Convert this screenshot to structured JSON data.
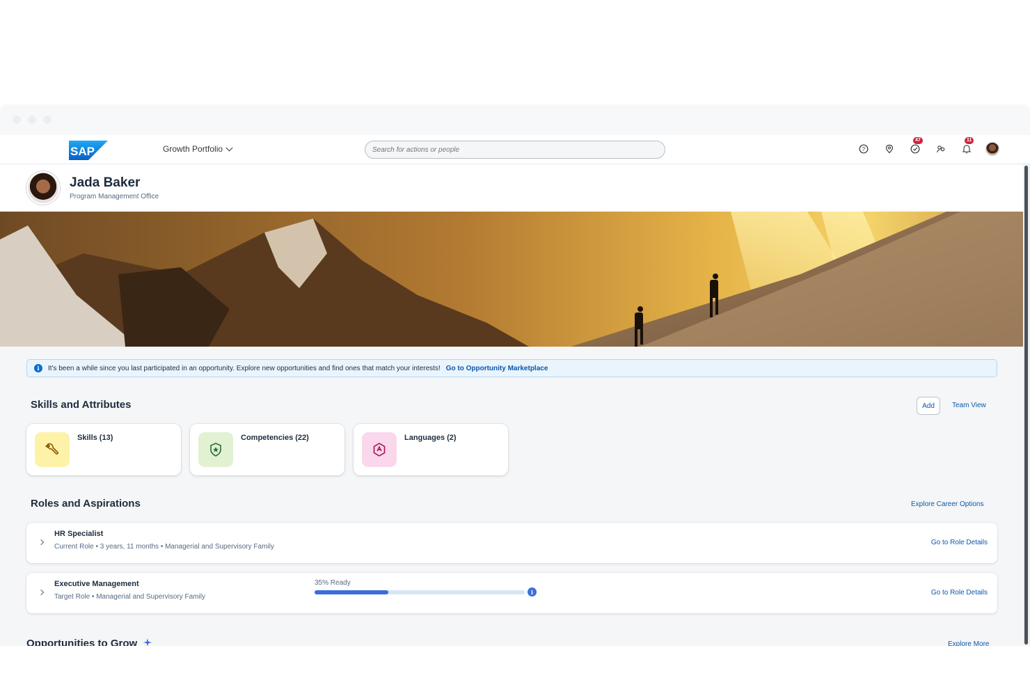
{
  "shell": {
    "logo_text": "SAP",
    "app_title": "Growth Portfolio",
    "search_placeholder": "Search for actions or people",
    "badges": {
      "tasks": "47",
      "notifications": "11"
    }
  },
  "profile": {
    "name": "Jada Baker",
    "department": "Program Management Office"
  },
  "info_strip": {
    "message": "It's been a while since you last participated in an opportunity. Explore new opportunities and find ones that match your interests!",
    "link": "Go to Opportunity Marketplace"
  },
  "skills": {
    "title": "Skills and Attributes",
    "add_label": "Add",
    "team_view_label": "Team View",
    "cards": [
      {
        "label": "Skills (13)"
      },
      {
        "label": "Competencies (22)"
      },
      {
        "label": "Languages (2)"
      }
    ]
  },
  "roles": {
    "title": "Roles and Aspirations",
    "explore_label": "Explore Career Options",
    "items": [
      {
        "name": "HR Specialist",
        "meta": "Current Role • 3 years, 11 months • Managerial and Supervisory Family",
        "link": "Go to Role Details"
      },
      {
        "name": "Executive Management",
        "meta": "Target Role • Managerial and Supervisory Family",
        "link": "Go to Role Details",
        "readiness_label": "35% Ready",
        "readiness": 35
      }
    ]
  },
  "opportunities": {
    "title": "Opportunities to Grow",
    "explore_label": "Explore More"
  },
  "colors": {
    "accent": "#0a57ad",
    "skills_bg": "#fdf2a8",
    "competencies_bg": "#e2f1d2",
    "languages_bg": "#fbd7ec",
    "badge": "#d0243f"
  }
}
